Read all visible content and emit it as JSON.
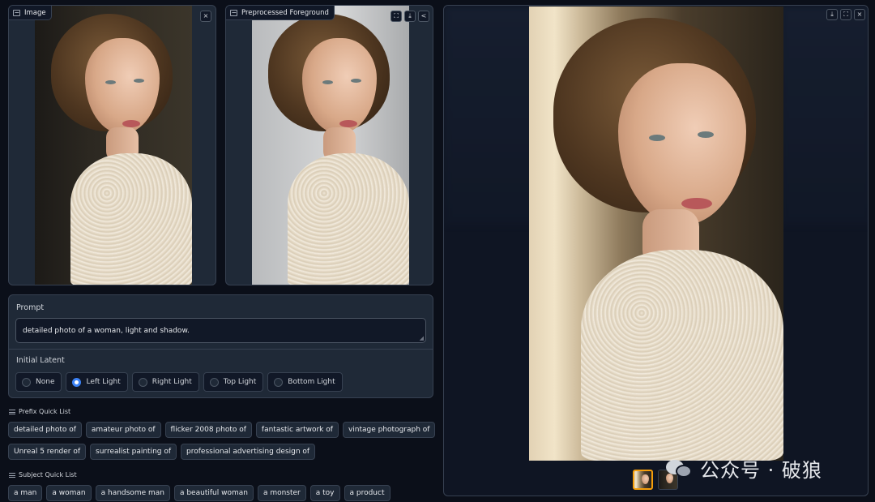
{
  "input_image": {
    "label": "Image"
  },
  "foreground": {
    "label": "Preprocessed Foreground"
  },
  "prompt": {
    "title": "Prompt",
    "value": "detailed photo of a woman, light and shadow."
  },
  "initial_latent": {
    "title": "Initial Latent",
    "options": [
      "None",
      "Left Light",
      "Right Light",
      "Top Light",
      "Bottom Light"
    ],
    "selected": "Left Light"
  },
  "prefix_quick_list": {
    "title": "Prefix Quick List",
    "row1": [
      "detailed photo of",
      "amateur photo of",
      "flicker 2008 photo of",
      "fantastic artwork of",
      "vintage photograph of"
    ],
    "row2": [
      "Unreal 5 render of",
      "surrealist painting of",
      "professional advertising design of"
    ]
  },
  "subject_quick_list": {
    "title": "Subject Quick List",
    "items": [
      "a man",
      "a woman",
      "a handsome man",
      "a beautiful woman",
      "a monster",
      "a toy",
      "a product"
    ]
  },
  "watermark": {
    "text": "公众号 · 破狼"
  },
  "icons": {
    "close": "×",
    "fullscreen": "⛶",
    "download": "⤓",
    "share": "<"
  }
}
